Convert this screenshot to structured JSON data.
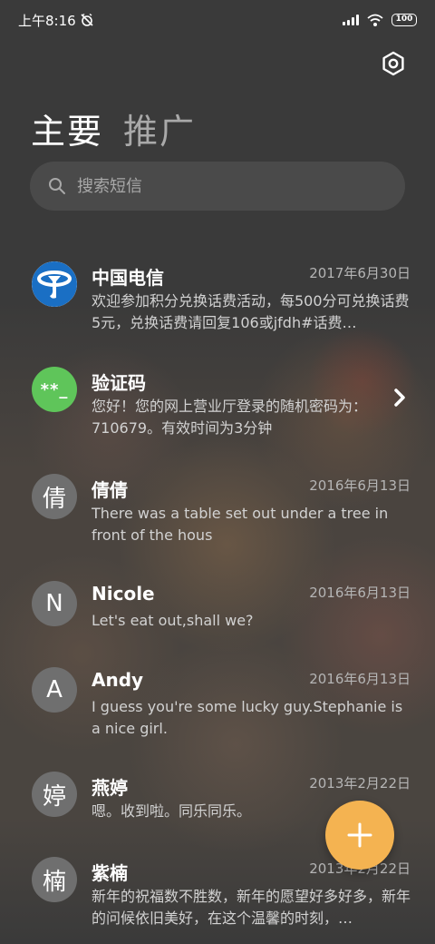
{
  "status_bar": {
    "time": "上午8:16",
    "battery": "100"
  },
  "header": {
    "settings_icon": "hexagon-settings-icon",
    "tabs": [
      {
        "label": "主要",
        "active": true
      },
      {
        "label": "推广",
        "active": false
      }
    ]
  },
  "search": {
    "placeholder": "搜索短信",
    "value": ""
  },
  "conversations": [
    {
      "avatar_text": "",
      "avatar_kind": "china-telecom-logo",
      "name": "中国电信",
      "date": "2017年6月30日",
      "snippet": "欢迎参加积分兑换话费活动，每500分可兑换话费5元，兑换话费请回复106或jfdh#话费…"
    },
    {
      "avatar_text": "**_",
      "avatar_kind": "verification-code",
      "name": "验证码",
      "date": "",
      "snippet": "您好！您的网上营业厅登录的随机密码为：710679。有效时间为3分钟"
    },
    {
      "avatar_text": "倩",
      "avatar_kind": "letter",
      "name": "倩倩",
      "date": "2016年6月13日",
      "snippet": "There was a table set out under a tree in front of the hous"
    },
    {
      "avatar_text": "N",
      "avatar_kind": "letter",
      "name": "Nicole",
      "date": "2016年6月13日",
      "snippet": "Let's eat out,shall we?"
    },
    {
      "avatar_text": "A",
      "avatar_kind": "letter",
      "name": "Andy",
      "date": "2016年6月13日",
      "snippet": "I guess you're some lucky guy.Stephanie is a nice girl."
    },
    {
      "avatar_text": "婷",
      "avatar_kind": "letter",
      "name": "燕婷",
      "date": "2013年2月22日",
      "snippet": "嗯。收到啦。同乐同乐。"
    },
    {
      "avatar_text": "楠",
      "avatar_kind": "letter",
      "name": "紫楠",
      "date": "2013年2月22日",
      "snippet": "新年的祝福数不胜数，新年的愿望好多好多，新年的问候依旧美好，在这个温馨的时刻，…"
    }
  ],
  "fab": {
    "icon": "plus-icon",
    "color": "#f4b351"
  },
  "colors": {
    "background": "#3b3b3b",
    "search_bg": "#4a4a4a",
    "avatar_gray": "#6f6f6f",
    "avatar_green": "#5fc55a",
    "telecom_blue": "#1a6fc4"
  }
}
